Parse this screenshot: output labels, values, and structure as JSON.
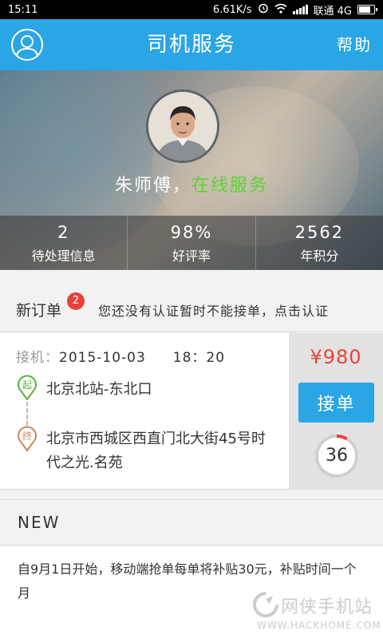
{
  "status_bar": {
    "time": "15:11",
    "net_speed": "6.61K/s",
    "carrier": "联通 4G"
  },
  "header": {
    "title": "司机服务",
    "help_label": "帮助"
  },
  "profile": {
    "name": "朱师傅",
    "separator": "，",
    "status": "在线服务",
    "status_color": "#5cd233"
  },
  "stats": [
    {
      "value": "2",
      "label": "待处理信息"
    },
    {
      "value": "98%",
      "label": "好评率"
    },
    {
      "value": "2562",
      "label": "年积分"
    }
  ],
  "new_order": {
    "label": "新订单",
    "badge": "2",
    "notice": "您还没有认证暂时不能接单，点击认证"
  },
  "order": {
    "pickup_label": "接机：",
    "pickup_date": "2015-10-03",
    "pickup_time": "18：20",
    "start_marker": "起",
    "end_marker": "终",
    "from": "北京北站-东北口",
    "to": "北京市西城区西直门北大街45号时代之光.名苑",
    "price": "¥980",
    "accept_label": "接单",
    "countdown": "36"
  },
  "news": {
    "heading": "NEW",
    "text": "自9月1日开始，移动端抢单每单将补贴30元，补贴时间一个月"
  },
  "watermark": {
    "cn": "网侠手机站",
    "en": "WWW.HACKHOME.COM"
  },
  "colors": {
    "primary": "#2aa5e6",
    "price": "#e8413c",
    "online": "#5cd233"
  }
}
